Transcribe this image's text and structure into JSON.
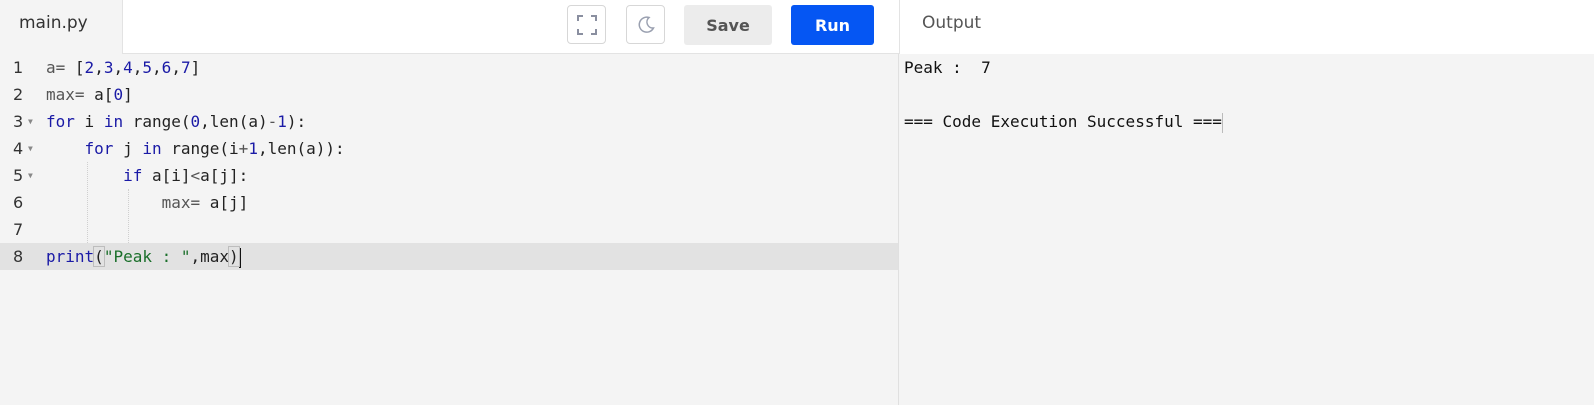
{
  "tabs": {
    "file_name": "main.py",
    "output_label": "Output"
  },
  "toolbar": {
    "fullscreen_icon": "fullscreen-icon",
    "theme_icon": "moon-icon",
    "save_label": "Save",
    "run_label": "Run",
    "run_color": "#0556f3"
  },
  "editor": {
    "line_numbers": [
      "1",
      "2",
      "3",
      "4",
      "5",
      "6",
      "7",
      "8"
    ],
    "active_line": "8",
    "lines": [
      "a= [2,3,4,5,6,7]",
      "max= a[0]",
      "for i in range(0,len(a)-1):",
      "    for j in range(i+1,len(a)):",
      "        if a[i]<a[j]:",
      "            max= a[j]",
      "",
      "print(\"Peak : \",max)"
    ]
  },
  "output": {
    "lines": [
      "Peak :  7",
      "",
      "=== Code Execution Successful ==="
    ]
  }
}
